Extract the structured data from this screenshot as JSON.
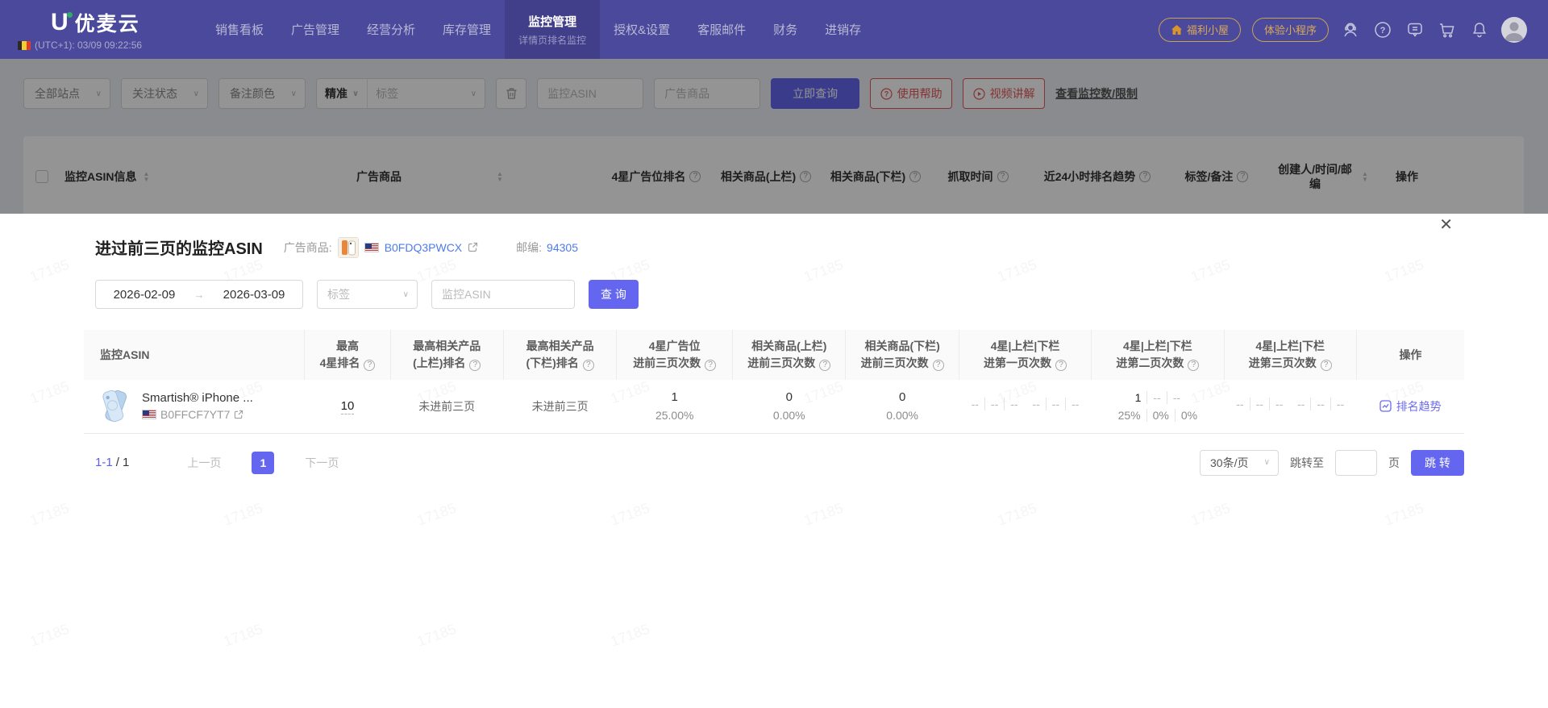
{
  "watermark": "17185",
  "nav": {
    "brand": "优麦云",
    "timezone": "(UTC+1): 03/09 09:22:56",
    "items": [
      "销售看板",
      "广告管理",
      "经营分析",
      "库存管理",
      "监控管理",
      "授权&设置",
      "客服邮件",
      "财务",
      "进销存"
    ],
    "active_subtitle": "详情页排名监控",
    "welfare_button": "福利小屋",
    "miniapp_button": "体验小程序"
  },
  "filter_bar": {
    "site_select": "全部站点",
    "follow_select": "关注状态",
    "color_select": "备注颜色",
    "match_select": "精准",
    "tag_select": "标签",
    "asin_placeholder": "监控ASIN",
    "product_placeholder": "广告商品",
    "query_button": "立即查询",
    "help_button": "使用帮助",
    "video_button": "视频讲解",
    "limit_link": "查看监控数/限制"
  },
  "bg_table": {
    "headers": [
      "监控ASIN信息",
      "广告商品",
      "4星广告位排名",
      "相关商品(上栏)",
      "相关商品(下栏)",
      "抓取时间",
      "近24小时排名趋势",
      "标签/备注",
      "创建人/时间/邮编",
      "操作"
    ]
  },
  "modal": {
    "title": "进过前三页的监控ASIN",
    "product_label": "广告商品:",
    "asin_link": "B0FDQ3PWCX",
    "zip_label": "邮编:",
    "zip_value": "94305",
    "date_from": "2026-02-09",
    "date_to": "2026-03-09",
    "tag_placeholder": "标签",
    "asin_placeholder": "监控ASIN",
    "query_button": "查 询",
    "table": {
      "headers": [
        {
          "line1": "监控ASIN",
          "line2": ""
        },
        {
          "line1": "最高",
          "line2": "4星排名"
        },
        {
          "line1": "最高相关产品",
          "line2": "(上栏)排名"
        },
        {
          "line1": "最高相关产品",
          "line2": "(下栏)排名"
        },
        {
          "line1": "4星广告位",
          "line2": "进前三页次数"
        },
        {
          "line1": "相关商品(上栏)",
          "line2": "进前三页次数"
        },
        {
          "line1": "相关商品(下栏)",
          "line2": "进前三页次数"
        },
        {
          "line1": "4星|上栏|下栏",
          "line2": "进第一页次数"
        },
        {
          "line1": "4星|上栏|下栏",
          "line2": "进第二页次数"
        },
        {
          "line1": "4星|上栏|下栏",
          "line2": "进第三页次数"
        },
        {
          "line1": "操作",
          "line2": ""
        }
      ],
      "row": {
        "product_title": "Smartish® iPhone ...",
        "product_asin": "B0FFCF7YT7",
        "best_rank": "10",
        "best_upper": "未进前三页",
        "best_lower": "未进前三页",
        "star4_count": "1",
        "star4_pct": "25.00%",
        "upper_count": "0",
        "upper_pct": "0.00%",
        "lower_count": "0",
        "lower_pct": "0.00%",
        "page1_top": [
          "--",
          "--",
          "--"
        ],
        "page1_bottom": [
          "--",
          "--",
          "--"
        ],
        "page2_top": [
          "1",
          "--",
          "--"
        ],
        "page2_bottom": [
          "25%",
          "0%",
          "0%"
        ],
        "page3_top": [
          "--",
          "--",
          "--"
        ],
        "page3_bottom": [
          "--",
          "--",
          "--"
        ],
        "action": "排名趋势"
      }
    },
    "pagination": {
      "range": "1-1",
      "total": "/ 1",
      "prev": "上一页",
      "page": "1",
      "next": "下一页",
      "page_size": "30条/页",
      "jump_label": "跳转至",
      "page_unit": "页",
      "jump_button": "跳 转"
    }
  }
}
